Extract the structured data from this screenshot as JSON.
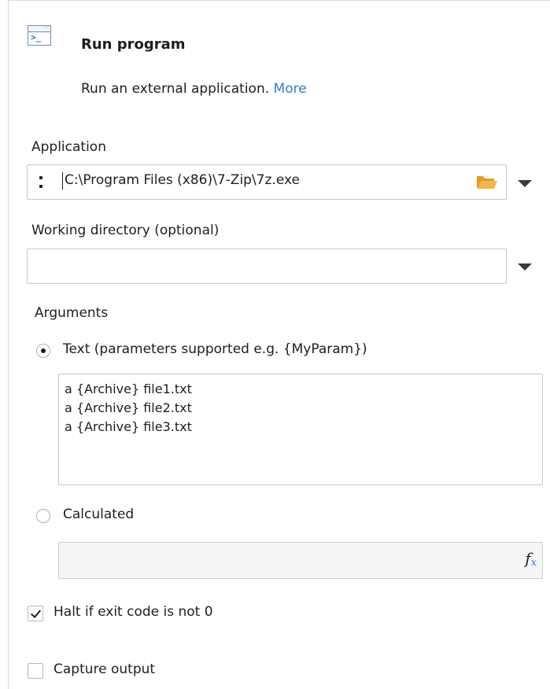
{
  "header": {
    "icon": "terminal-window-icon",
    "icon_prompt": ">_",
    "title": "Run program",
    "description": "Run an external application.",
    "more_link": "More"
  },
  "application": {
    "label": "Application",
    "value": "C:\\Program Files (x86)\\7-Zip\\7z.exe",
    "browse_icon": "folder-icon",
    "dropdown_icon": "chevron-down-icon"
  },
  "working_directory": {
    "label": "Working directory (optional)",
    "value": "",
    "dropdown_icon": "chevron-down-icon"
  },
  "arguments": {
    "label": "Arguments",
    "text_option": {
      "label": "Text (parameters supported e.g. {MyParam})",
      "selected": true
    },
    "lines": [
      "a {Archive} file1.txt",
      "a {Archive} file2.txt",
      "a {Archive} file3.txt"
    ],
    "calculated_option": {
      "label": "Calculated",
      "selected": false
    },
    "calculated_value": "",
    "fx_icon": "function-fx-icon",
    "fx_glyph": "f",
    "fx_sub": "x"
  },
  "options": {
    "halt": {
      "label": "Halt if exit code is not 0",
      "checked": true
    },
    "capture": {
      "label": "Capture output",
      "checked": false
    }
  },
  "colors": {
    "link": "#2a7fd4",
    "folder": "#f2a93b",
    "text": "#1e1e1e",
    "border": "#c8c8c8"
  }
}
